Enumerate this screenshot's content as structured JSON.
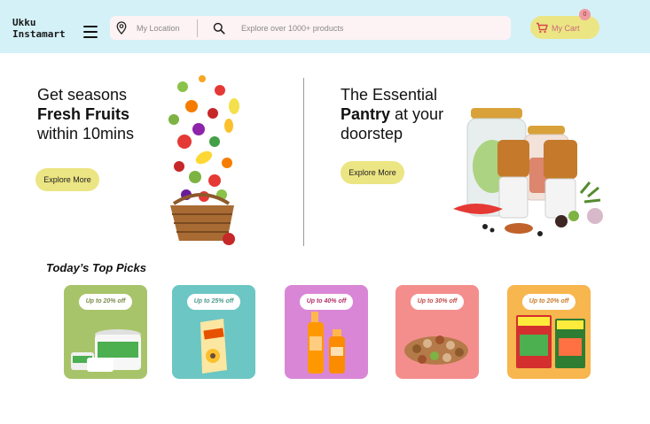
{
  "header": {
    "logo_line1": "Ukku",
    "logo_line2": "Instamart",
    "location_placeholder": "My Location",
    "search_placeholder": "Explore over 1000+ products",
    "cart_label": "My Cart",
    "cart_count": "0"
  },
  "banners": [
    {
      "line1": "Get seasons",
      "line2_bold": "Fresh Fruits",
      "line3": "within 10mins",
      "button": "Explore More"
    },
    {
      "line1": "The Essential",
      "line2_bold": "Pantry",
      "line2_rest": " at your",
      "line3": "doorstep",
      "button": "Explore More"
    }
  ],
  "top_picks": {
    "title": "Today’s Top Picks",
    "items": [
      {
        "offer": "Up to 20% off",
        "bg": "#a8c46a",
        "offer_color": "#7a8a4a",
        "icon": "curd-tub-icon"
      },
      {
        "offer": "Up to 25% off",
        "bg": "#6cc6c4",
        "offer_color": "#4a9a8a",
        "icon": "oil-pouch-icon"
      },
      {
        "offer": "Up to 40% off",
        "bg": "#d986d6",
        "offer_color": "#b0306a",
        "icon": "shampoo-bottle-icon"
      },
      {
        "offer": "Up to 30% off",
        "bg": "#f48e8c",
        "offer_color": "#c04a4a",
        "icon": "dry-fruits-icon"
      },
      {
        "offer": "Up to 20% off",
        "bg": "#f7b64e",
        "offer_color": "#c77a2a",
        "icon": "masala-box-icon"
      }
    ]
  }
}
